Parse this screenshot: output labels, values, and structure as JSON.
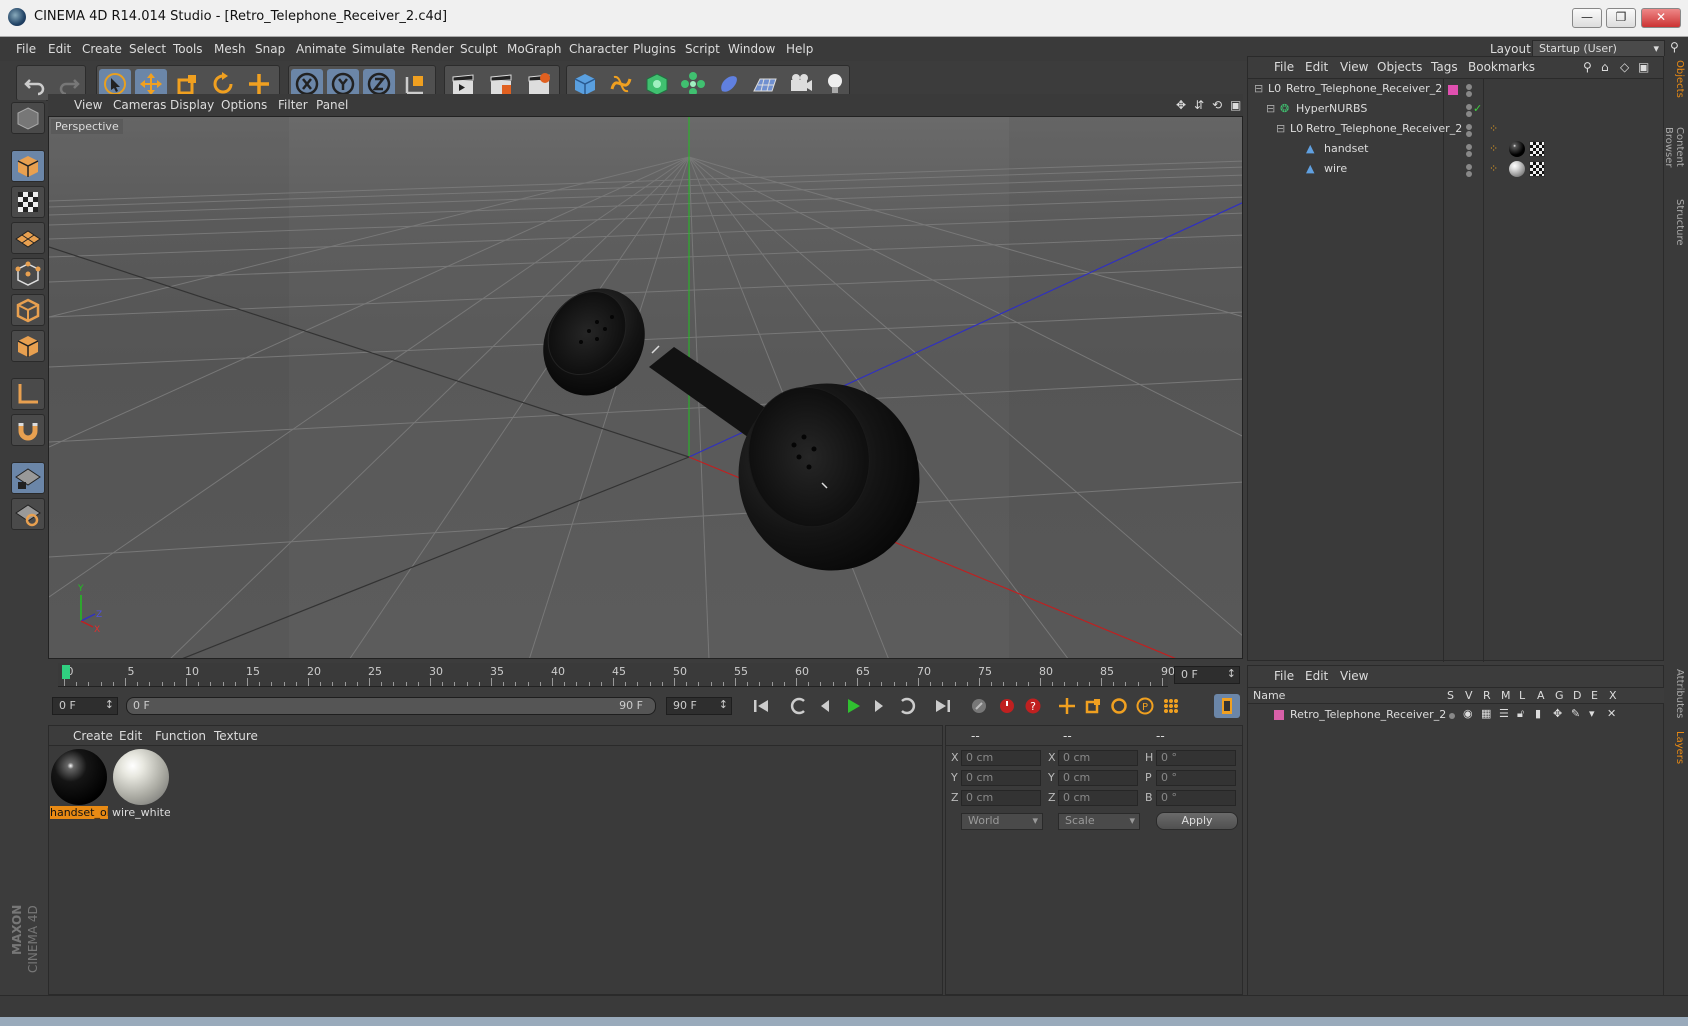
{
  "window": {
    "title": "CINEMA 4D R14.014 Studio - [Retro_Telephone_Receiver_2.c4d]",
    "min_glyph": "—",
    "max_glyph": "❐",
    "close_glyph": "✕"
  },
  "menubar": {
    "items": [
      "File",
      "Edit",
      "Create",
      "Select",
      "Tools",
      "Mesh",
      "Snap",
      "Animate",
      "Simulate",
      "Render",
      "Sculpt",
      "MoGraph",
      "Character",
      "Plugins",
      "Script",
      "Window",
      "Help"
    ],
    "layout_label": "Layout:",
    "layout_value": "Startup (User)"
  },
  "viewport": {
    "menu": [
      "View",
      "Cameras",
      "Display",
      "Options",
      "Filter",
      "Panel"
    ],
    "label": "Perspective",
    "axis_y": "Y",
    "axis_z": "Z",
    "axis_x": "X"
  },
  "timeline": {
    "ticks": [
      0,
      5,
      10,
      15,
      20,
      25,
      30,
      35,
      40,
      45,
      50,
      55,
      60,
      65,
      70,
      75,
      80,
      85,
      90
    ],
    "current_frame": "0 F",
    "start_frame": "0 F",
    "range_start": "0 F",
    "range_end": "90 F",
    "end_frame": "90 F"
  },
  "materials": {
    "menu": [
      "Create",
      "Edit",
      "Function",
      "Texture"
    ],
    "items": [
      {
        "label": "handset_ol",
        "selected": true,
        "color": "#111111"
      },
      {
        "label": "wire_white",
        "selected": false,
        "color": "#d8d8d0"
      }
    ]
  },
  "coordinates": {
    "headers": [
      "--",
      "--",
      "--"
    ],
    "rows": [
      {
        "l1": "X",
        "v1": "0 cm",
        "l2": "X",
        "v2": "0 cm",
        "l3": "H",
        "v3": "0 °"
      },
      {
        "l1": "Y",
        "v1": "0 cm",
        "l2": "Y",
        "v2": "0 cm",
        "l3": "P",
        "v3": "0 °"
      },
      {
        "l1": "Z",
        "v1": "0 cm",
        "l2": "Z",
        "v2": "0 cm",
        "l3": "B",
        "v3": "0 °"
      }
    ],
    "space": "World",
    "mode": "Scale",
    "apply": "Apply"
  },
  "objects": {
    "menu": [
      "File",
      "Edit",
      "View",
      "Objects",
      "Tags",
      "Bookmarks"
    ],
    "tree": [
      {
        "name": "Retro_Telephone_Receiver_2",
        "indent": 0,
        "icon": "null-object-icon"
      },
      {
        "name": "HyperNURBS",
        "indent": 1,
        "icon": "hypernurbs-icon"
      },
      {
        "name": "Retro_Telephone_Receiver_2",
        "indent": 2,
        "icon": "null-object-icon"
      },
      {
        "name": "handset",
        "indent": 3,
        "icon": "polygon-object-icon"
      },
      {
        "name": "wire",
        "indent": 3,
        "icon": "polygon-object-icon"
      }
    ]
  },
  "layers": {
    "menu": [
      "File",
      "Edit",
      "View"
    ],
    "columns": [
      "Name",
      "S",
      "V",
      "R",
      "M",
      "L",
      "A",
      "G",
      "D",
      "E",
      "X"
    ],
    "rows": [
      {
        "name": "Retro_Telephone_Receiver_2",
        "color": "#d860a8"
      }
    ]
  },
  "right_tabs": [
    "Objects",
    "Content Browser",
    "Structure",
    "Attributes",
    "Layers"
  ],
  "brand": {
    "line1": "MAXON",
    "line2": "CINEMA 4D"
  },
  "colors": {
    "accent": "#e88a14",
    "active_blue": "#6b86a8"
  }
}
